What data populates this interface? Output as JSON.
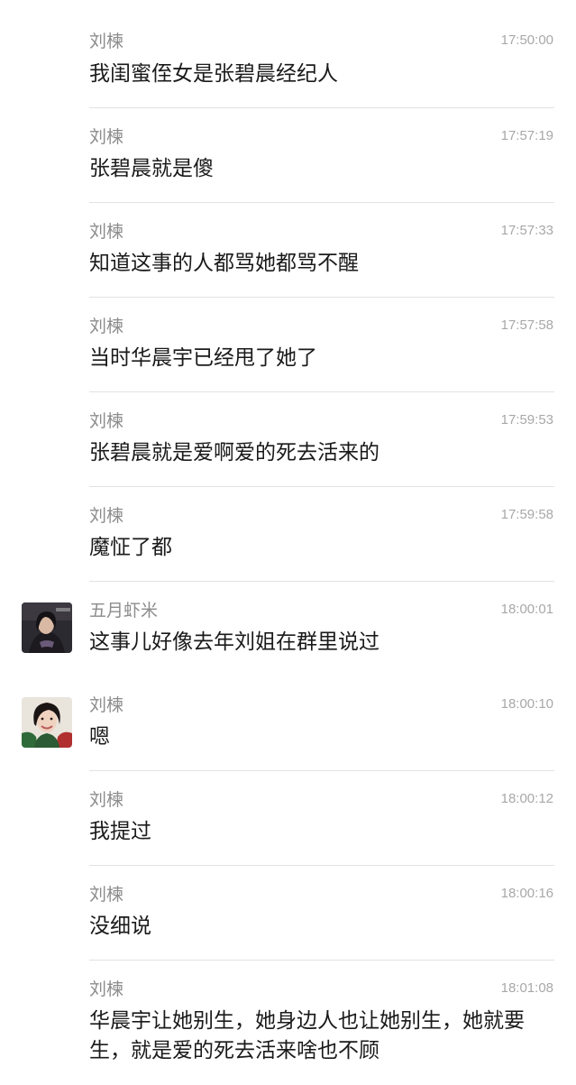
{
  "messages": [
    {
      "sender": "刘楝",
      "time": "17:50:00",
      "text": "我闺蜜侄女是张碧晨经纪人",
      "avatar": ""
    },
    {
      "sender": "刘楝",
      "time": "17:57:19",
      "text": "张碧晨就是傻",
      "avatar": ""
    },
    {
      "sender": "刘楝",
      "time": "17:57:33",
      "text": "知道这事的人都骂她都骂不醒",
      "avatar": ""
    },
    {
      "sender": "刘楝",
      "time": "17:57:58",
      "text": "当时华晨宇已经甩了她了",
      "avatar": ""
    },
    {
      "sender": "刘楝",
      "time": "17:59:53",
      "text": "张碧晨就是爱啊爱的死去活来的",
      "avatar": ""
    },
    {
      "sender": "刘楝",
      "time": "17:59:58",
      "text": "魔怔了都",
      "avatar": ""
    },
    {
      "sender": "五月虾米",
      "time": "18:00:01",
      "text": "这事儿好像去年刘姐在群里说过",
      "avatar": "wuyuexiami-avatar"
    },
    {
      "sender": "刘楝",
      "time": "18:00:10",
      "text": "嗯",
      "avatar": "liu-avatar"
    },
    {
      "sender": "刘楝",
      "time": "18:00:12",
      "text": "我提过",
      "avatar": ""
    },
    {
      "sender": "刘楝",
      "time": "18:00:16",
      "text": "没细说",
      "avatar": ""
    },
    {
      "sender": "刘楝",
      "time": "18:01:08",
      "text": "华晨宇让她别生，她身边人也让她别生，她就要生，就是爱的死去活来啥也不顾",
      "avatar": ""
    }
  ]
}
